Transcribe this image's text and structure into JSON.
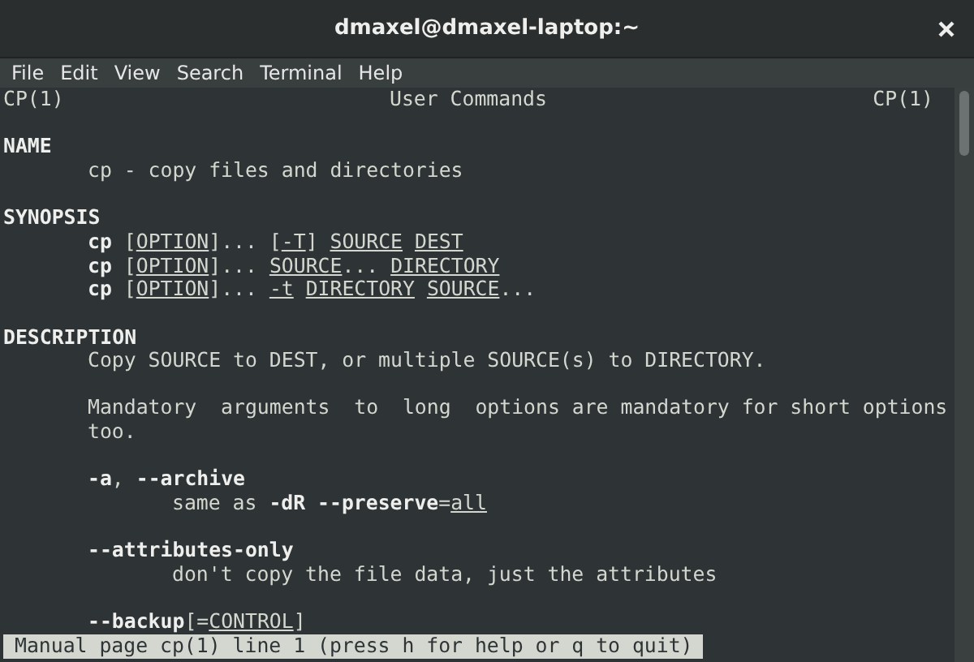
{
  "window": {
    "title": "dmaxel@dmaxel-laptop:~"
  },
  "menu": [
    "File",
    "Edit",
    "View",
    "Search",
    "Terminal",
    "Help"
  ],
  "man_header": {
    "left": "CP(1)",
    "center": "User Commands",
    "right": "CP(1)"
  },
  "lines": [
    {
      "kind": "blank"
    },
    {
      "kind": "heading",
      "parts": [
        {
          "kind": "text",
          "text": "NAME"
        }
      ]
    },
    {
      "kind": "body",
      "parts": [
        {
          "kind": "text",
          "text": "cp - copy files and directories"
        }
      ]
    },
    {
      "kind": "blank"
    },
    {
      "kind": "heading",
      "parts": [
        {
          "kind": "text",
          "text": "SYNOPSIS"
        }
      ]
    },
    {
      "kind": "body",
      "parts": [
        {
          "kind": "command",
          "text": "cp"
        },
        {
          "kind": "text",
          "text": " ["
        },
        {
          "kind": "argument",
          "text": "OPTION"
        },
        {
          "kind": "text",
          "text": "]... ["
        },
        {
          "kind": "argument",
          "text": "-T"
        },
        {
          "kind": "text",
          "text": "] "
        },
        {
          "kind": "argument",
          "text": "SOURCE"
        },
        {
          "kind": "argument",
          "text": " DEST"
        }
      ]
    },
    {
      "kind": "body",
      "parts": [
        {
          "kind": "command",
          "text": "cp"
        },
        {
          "kind": "text",
          "text": " ["
        },
        {
          "kind": "argument",
          "text": "OPTION"
        },
        {
          "kind": "text",
          "text": "]... "
        },
        {
          "kind": "argument",
          "text": "SOURCE"
        },
        {
          "kind": "text",
          "text": "... "
        },
        {
          "kind": "argument",
          "text": "DIRECTORY"
        }
      ]
    },
    {
      "kind": "body",
      "parts": [
        {
          "kind": "command",
          "text": "cp"
        },
        {
          "kind": "text",
          "text": " ["
        },
        {
          "kind": "argument",
          "text": "OPTION"
        },
        {
          "kind": "text",
          "text": "]... "
        },
        {
          "kind": "argument",
          "text": "-t"
        },
        {
          "kind": "argument",
          "text": " DIRECTORY"
        },
        {
          "kind": "argument",
          "text": " SOURCE"
        },
        {
          "kind": "text",
          "text": "..."
        }
      ]
    },
    {
      "kind": "blank"
    },
    {
      "kind": "heading",
      "parts": [
        {
          "kind": "text",
          "text": "DESCRIPTION"
        }
      ]
    },
    {
      "kind": "body",
      "parts": [
        {
          "kind": "text",
          "text": "Copy SOURCE to DEST, or multiple SOURCE(s) to DIRECTORY."
        }
      ]
    },
    {
      "kind": "blank"
    },
    {
      "kind": "body",
      "parts": [
        {
          "kind": "text",
          "text": "Mandatory  arguments  to  long  options are mandatory for short options"
        }
      ]
    },
    {
      "kind": "body",
      "parts": [
        {
          "kind": "text",
          "text": "too."
        }
      ]
    },
    {
      "kind": "blank"
    },
    {
      "kind": "body",
      "parts": [
        {
          "kind": "option",
          "text": "-a"
        },
        {
          "kind": "text",
          "text": ", "
        },
        {
          "kind": "option",
          "text": "--archive"
        }
      ]
    },
    {
      "kind": "detail",
      "parts": [
        {
          "kind": "text",
          "text": "same as "
        },
        {
          "kind": "option",
          "text": "-dR --preserve"
        },
        {
          "kind": "text",
          "text": "="
        },
        {
          "kind": "argument",
          "text": "all"
        }
      ]
    },
    {
      "kind": "blank"
    },
    {
      "kind": "body",
      "parts": [
        {
          "kind": "option",
          "text": "--attributes-only"
        }
      ]
    },
    {
      "kind": "detail",
      "parts": [
        {
          "kind": "text",
          "text": "don't copy the file data, just the attributes"
        }
      ]
    },
    {
      "kind": "blank"
    },
    {
      "kind": "body",
      "parts": [
        {
          "kind": "option",
          "text": "--backup"
        },
        {
          "kind": "text",
          "text": "[="
        },
        {
          "kind": "argument",
          "text": "CONTROL"
        },
        {
          "kind": "text",
          "text": "]"
        }
      ]
    }
  ],
  "status_bar": "Manual page cp(1) line 1 (press h for help or q to quit)"
}
